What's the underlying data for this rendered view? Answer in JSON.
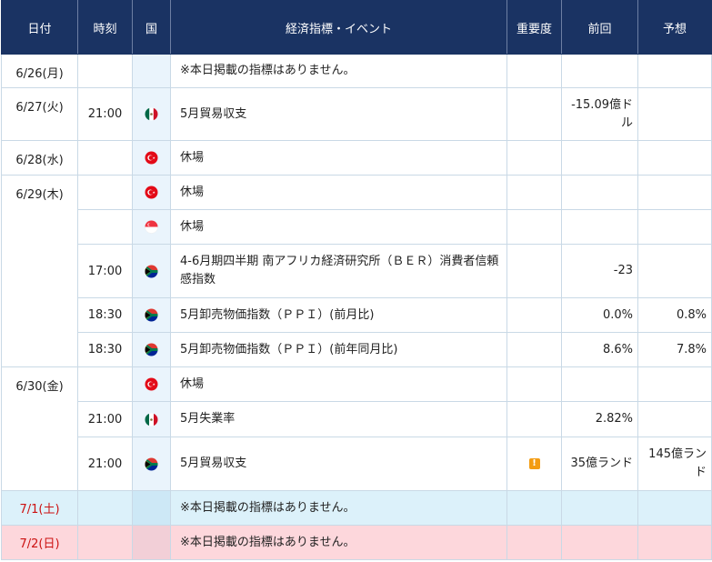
{
  "header": {
    "date": "日付",
    "time": "時刻",
    "country": "国",
    "event": "経済指標・イベント",
    "importance": "重要度",
    "previous": "前回",
    "forecast": "予想"
  },
  "rows": [
    {
      "date": "6/26(月)",
      "time": "",
      "flag": "none",
      "event": "※本日掲載の指標はありません。",
      "previous": "",
      "forecast": ""
    },
    {
      "date": "6/27(火)",
      "time": "21:00",
      "flag": "mexico-flag-icon",
      "event": "5月貿易収支",
      "previous": "-15.09億ドル",
      "forecast": ""
    },
    {
      "date": "6/28(水)",
      "time": "",
      "flag": "turkey-flag-icon",
      "event": "休場",
      "previous": "",
      "forecast": ""
    },
    {
      "date": "6/29(木)",
      "time": "",
      "flag": "turkey-flag-icon",
      "event": "休場",
      "previous": "",
      "forecast": ""
    },
    {
      "date": "",
      "time": "",
      "flag": "singapore-flag-icon",
      "event": "休場",
      "previous": "",
      "forecast": ""
    },
    {
      "date": "",
      "time": "17:00",
      "flag": "south-africa-flag-icon",
      "event": "4-6月期四半期 南アフリカ経済研究所（ＢＥＲ）消費者信頼感指数",
      "previous": "-23",
      "forecast": ""
    },
    {
      "date": "",
      "time": "18:30",
      "flag": "south-africa-flag-icon",
      "event": "5月卸売物価指数（ＰＰＩ）(前月比)",
      "previous": "0.0%",
      "forecast": "0.8%"
    },
    {
      "date": "",
      "time": "18:30",
      "flag": "south-africa-flag-icon",
      "event": "5月卸売物価指数（ＰＰＩ）(前年同月比)",
      "previous": "8.6%",
      "forecast": "7.8%"
    },
    {
      "date": "6/30(金)",
      "time": "",
      "flag": "turkey-flag-icon",
      "event": "休場",
      "previous": "",
      "forecast": ""
    },
    {
      "date": "",
      "time": "21:00",
      "flag": "mexico-flag-icon",
      "event": "5月失業率",
      "previous": "2.82%",
      "forecast": ""
    },
    {
      "date": "",
      "time": "21:00",
      "flag": "south-africa-flag-icon",
      "event": "5月貿易収支",
      "importance": "!",
      "previous": "35億ランド",
      "forecast": "145億ランド"
    },
    {
      "date": "7/1(土)",
      "time": "",
      "flag": "none",
      "event": "※本日掲載の指標はありません。",
      "previous": "",
      "forecast": ""
    },
    {
      "date": "7/2(日)",
      "time": "",
      "flag": "none",
      "event": "※本日掲載の指標はありません。",
      "previous": "",
      "forecast": ""
    }
  ],
  "colors": {
    "header_bg": "#1a3363",
    "saturday_bg": "#dcf1fa",
    "sunday_bg": "#fdd7dc",
    "weekend_date": "#cc1111",
    "importance_alert": "#f39c12"
  }
}
